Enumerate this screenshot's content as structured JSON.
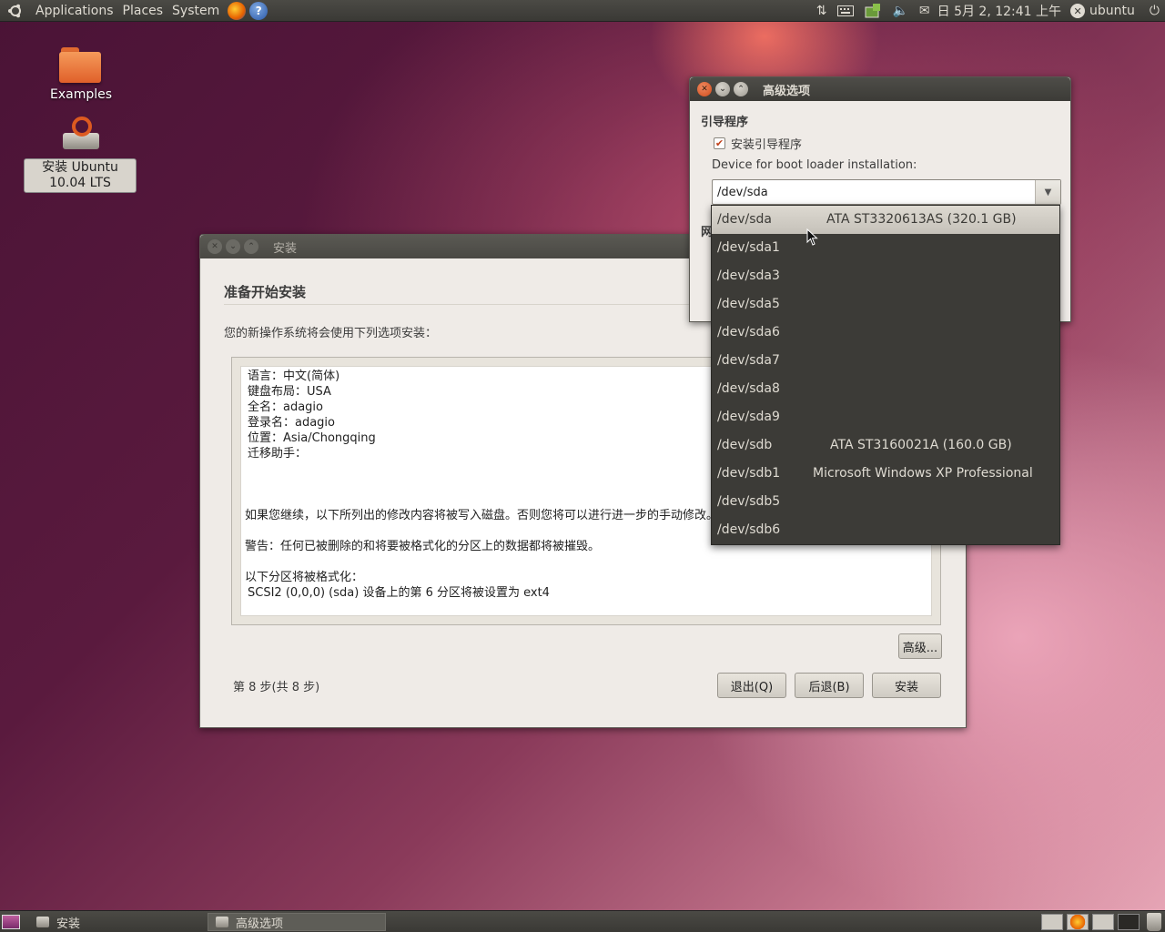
{
  "top_panel": {
    "menus": [
      "Applications",
      "Places",
      "System"
    ],
    "clock": "日 5月 2, 12:41 上午",
    "user": "ubuntu"
  },
  "desktop": {
    "examples_label": "Examples",
    "install_label": "安装 Ubuntu 10.04 LTS"
  },
  "install_window": {
    "title": "安装",
    "heading": "准备开始安装",
    "subtitle": "您的新操作系统将会使用下列选项安装：",
    "summary_lines": [
      "语言：中文(简体)",
      "键盘布局：USA",
      "全名：adagio",
      "登录名：adagio",
      "位置：Asia/Chongqing",
      "迁移助手："
    ],
    "summary_notice": "如果您继续，以下所列出的修改内容将被写入磁盘。否则您将可以进行进一步的手动修改。",
    "summary_warning": "警告：任何已被删除的和将要被格式化的分区上的数据都将被摧毁。",
    "summary_format_title": "以下分区将被格式化：",
    "summary_format_item": "SCSI2 (0,0,0) (sda) 设备上的第 6 分区将被设置为 ext4",
    "advanced_button": "高级...",
    "step_label": "第 8 步(共 8 步)",
    "quit_button": "退出(Q)",
    "back_button": "后退(B)",
    "install_button": "安装"
  },
  "advanced_window": {
    "title": "高级选项",
    "section_bootloader": "引导程序",
    "install_bootloader_label": "安装引导程序",
    "install_bootloader_checked": true,
    "device_label": "Device for boot loader installation:",
    "device_value": "/dev/sda",
    "partially_hidden_label": "网"
  },
  "dropdown": {
    "items": [
      {
        "device": "/dev/sda",
        "description": "ATA ST3320613AS (320.1 GB)",
        "selected": true
      },
      {
        "device": "/dev/sda1",
        "description": ""
      },
      {
        "device": "/dev/sda3",
        "description": ""
      },
      {
        "device": "/dev/sda5",
        "description": ""
      },
      {
        "device": "/dev/sda6",
        "description": ""
      },
      {
        "device": "/dev/sda7",
        "description": ""
      },
      {
        "device": "/dev/sda8",
        "description": ""
      },
      {
        "device": "/dev/sda9",
        "description": ""
      },
      {
        "device": "/dev/sdb",
        "description": "ATA ST3160021A (160.0 GB)"
      },
      {
        "device": "/dev/sdb1",
        "description": "Microsoft Windows XP Professional"
      },
      {
        "device": "/dev/sdb5",
        "description": ""
      },
      {
        "device": "/dev/sdb6",
        "description": ""
      }
    ]
  },
  "bottom_panel": {
    "tasks": [
      "安装",
      "高级选项"
    ]
  },
  "icons": {
    "ubuntu": "ubuntu-logo-icon",
    "firefox": "firefox-icon",
    "help": "help-icon",
    "network": "network-icon",
    "keyboard": "keyboard-icon",
    "volume": "volume-icon",
    "mail": "mail-icon",
    "power": "power-icon"
  },
  "colors": {
    "panel": "#3c3b37",
    "close_button": "#d04a1a",
    "selected_row": "#ddd9d1"
  }
}
